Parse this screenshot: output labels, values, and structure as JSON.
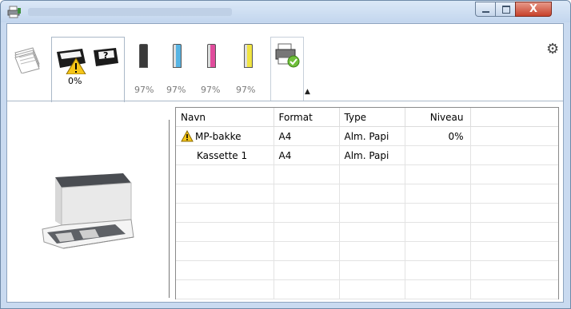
{
  "window": {
    "close_label": "X"
  },
  "toolbar": {
    "tab_alert_value": "0%",
    "toner": [
      {
        "icon": "toner-black-icon",
        "color": "#3a3a3a",
        "value": "97%"
      },
      {
        "icon": "toner-cyan-icon",
        "color": "#57b4e3",
        "value": "97%"
      },
      {
        "icon": "toner-magenta-icon",
        "color": "#e04c9c",
        "value": "97%"
      },
      {
        "icon": "toner-yellow-icon",
        "color": "#f0e442",
        "value": "97%"
      }
    ],
    "gear_glyph": "⚙",
    "collapse_glyph": "▲"
  },
  "tray_table": {
    "columns": [
      "Navn",
      "Format",
      "Type",
      "Niveau"
    ],
    "rows": [
      {
        "warning": true,
        "name": "MP-bakke",
        "format": "A4",
        "type": "Alm. Papi",
        "level": "0%"
      },
      {
        "warning": false,
        "name": "Kassette 1",
        "format": "A4",
        "type": "Alm. Papi",
        "level": ""
      }
    ]
  }
}
